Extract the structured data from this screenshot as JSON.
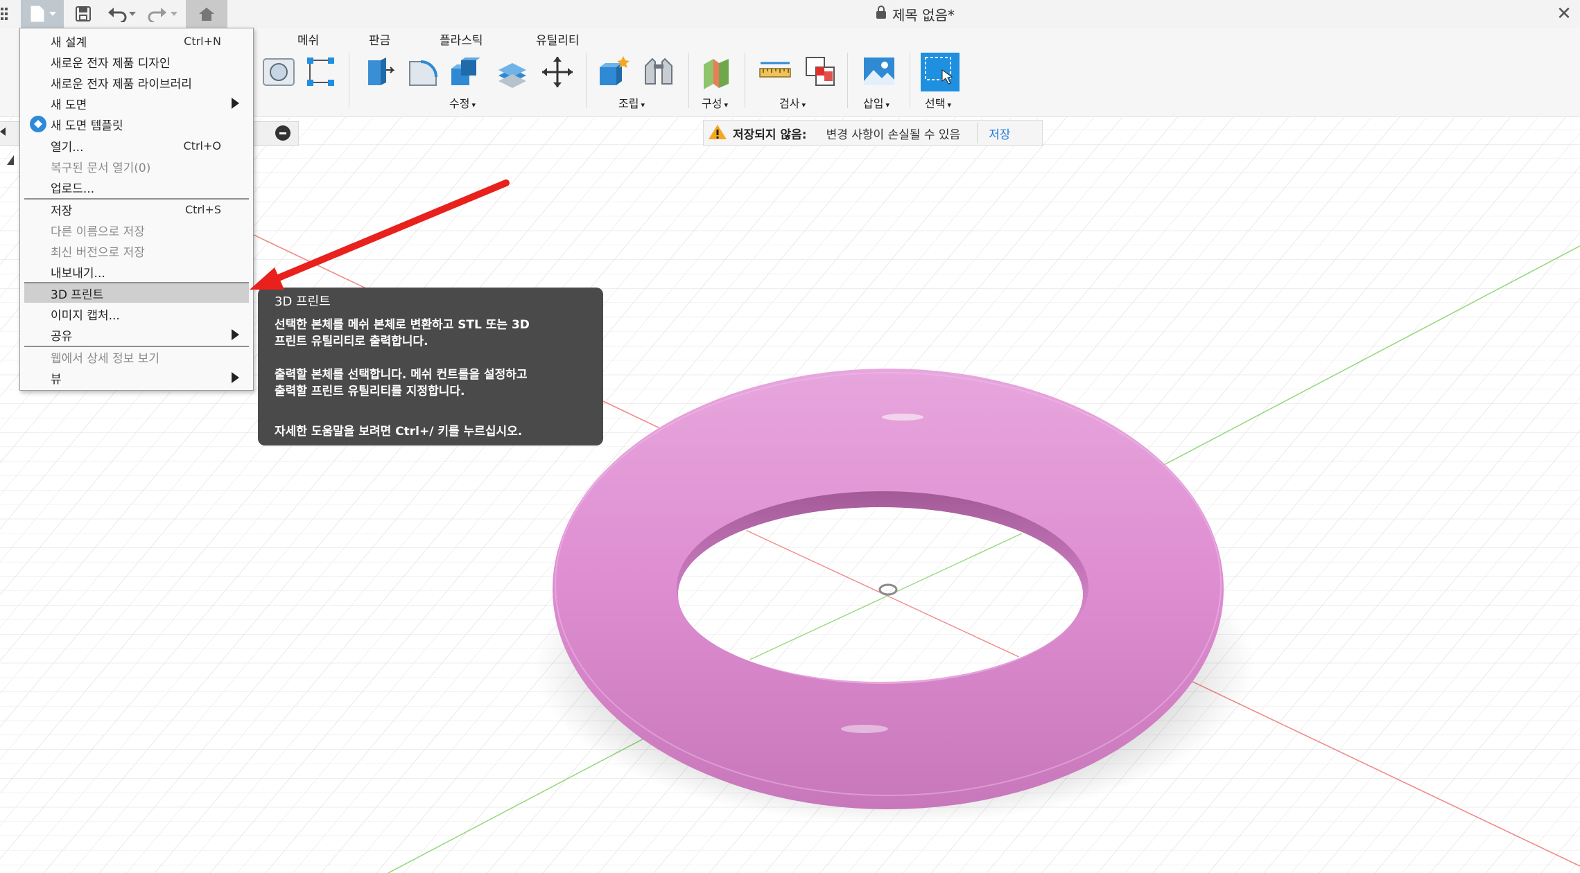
{
  "document": {
    "title": "제목 없음*"
  },
  "quick_access": {
    "grid_icon": "apps-grid-icon",
    "file_icon": "file-icon",
    "save_icon": "save-icon",
    "undo_icon": "undo-icon",
    "redo_icon": "redo-icon",
    "home_icon": "home-icon",
    "close_glyph": "✕"
  },
  "toolbar": {
    "tabs": [
      "메쉬",
      "판금",
      "플라스틱",
      "유틸리티"
    ],
    "groups": {
      "modify": "수정",
      "assemble": "조립",
      "construct": "구성",
      "inspect": "검사",
      "insert": "삽입",
      "select": "선택"
    },
    "caret": "▾"
  },
  "warning": {
    "title": "저장되지 않음:",
    "message": "변경 사항이 손실될 수 있음",
    "action": "저장"
  },
  "file_menu": {
    "items": [
      {
        "label": "새 설계",
        "shortcut": "Ctrl+N"
      },
      {
        "label": "새로운 전자 제품 디자인"
      },
      {
        "label": "새로운 전자 제품 라이브러리"
      },
      {
        "label": "새 도면"
      },
      {
        "label": "새 도면 템플릿"
      },
      {
        "label": "열기...",
        "shortcut": "Ctrl+O"
      },
      {
        "label": "복구된 문서 열기(0)"
      },
      {
        "label": "업로드..."
      },
      {
        "label": "저장",
        "shortcut": "Ctrl+S"
      },
      {
        "label": "다른 이름으로 저장"
      },
      {
        "label": "최신 버전으로 저장"
      },
      {
        "label": "내보내기..."
      },
      {
        "label": "3D 프린트"
      },
      {
        "label": "이미지 캡처..."
      },
      {
        "label": "공유"
      },
      {
        "label": "웹에서 상세 정보 보기"
      },
      {
        "label": "뷰"
      }
    ]
  },
  "tooltip": {
    "title": "3D 프린트",
    "line1": "선택한 본체를 메쉬 본체로 변환하고 STL 또는 3D",
    "line2": "프린트 유틸리티로 출력합니다.",
    "line3": "출력할 본체를 선택합니다. 메쉬 컨트롤을 설정하고",
    "line4": "출력할 프린트 유틸리티를 지정합니다.",
    "line5": "자세한 도움말을 보려면 Ctrl+/ 키를 누르십시오."
  },
  "colors": {
    "torus": "#e08fd3",
    "annotation_arrow": "#e8211d",
    "select_tool": "#1f8fe0",
    "tooltip_bg": "#4a4a4a",
    "link": "#1f7ad8"
  }
}
